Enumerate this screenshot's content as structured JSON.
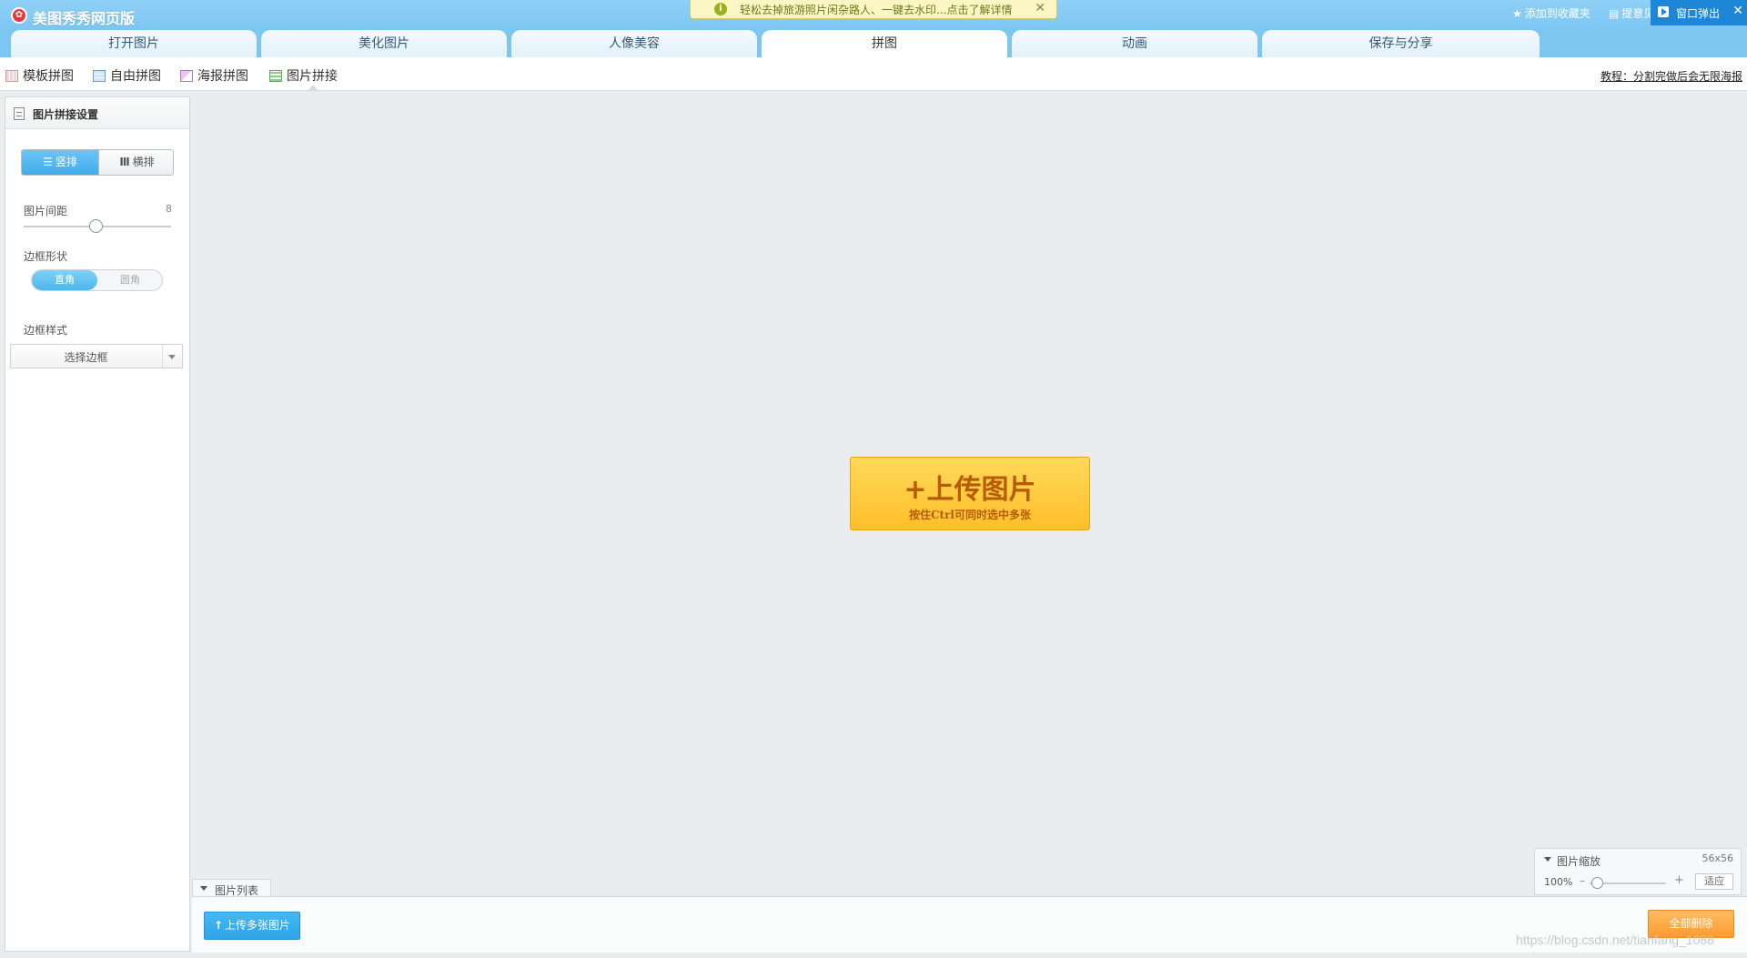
{
  "app": {
    "title": "美图秀秀网页版",
    "notice": "轻松去掉旅游照片闲杂路人、一键去水印...点击了解详情",
    "add_favorite": "添加到收藏夹",
    "feedback": "提意见",
    "popup_window": "窗口弹出"
  },
  "tabs": [
    {
      "label": "打开图片",
      "active": false
    },
    {
      "label": "美化图片",
      "active": false
    },
    {
      "label": "人像美容",
      "active": false
    },
    {
      "label": "拼图",
      "active": true
    },
    {
      "label": "动画",
      "active": false
    },
    {
      "label": "保存与分享",
      "active": false
    }
  ],
  "subtoolbar": {
    "items": [
      {
        "label": "模板拼图",
        "icon": "template-collage-icon"
      },
      {
        "label": "自由拼图",
        "icon": "free-collage-icon"
      },
      {
        "label": "海报拼图",
        "icon": "poster-collage-icon"
      },
      {
        "label": "图片拼接",
        "icon": "image-stitch-icon"
      }
    ],
    "active_index": 3,
    "tutorial": "教程：分割完做后会无限海报"
  },
  "settings_panel": {
    "title": "图片拼接设置",
    "layout_vertical": "竖排",
    "layout_horizontal": "横排",
    "spacing_label": "图片间距",
    "spacing_value": "8",
    "spacing_slider": 0.5,
    "border_shape_label": "边框形状",
    "shape_square": "直角",
    "shape_round": "圆角",
    "border_style_label": "边框样式",
    "border_select": "选择边框"
  },
  "canvas": {
    "upload_label": "+上传图片",
    "upload_hint": "按住Ctrl可同时选中多张"
  },
  "zoom": {
    "title": "图片缩放",
    "size": "56x56",
    "percent": "100%",
    "minus": "–",
    "plus": "+",
    "fit": "适应"
  },
  "image_list": {
    "tab_label": "图片列表",
    "upload_multi": "上传多张图片",
    "delete_all": "全部删除"
  },
  "watermark": "https://blog.csdn.net/tianfang_1088",
  "colors": {
    "titlebar": "#7cc6f2",
    "accent_blue": "#41aceb",
    "upload_yellow": "#ffbf2a",
    "delete_orange": "#ff9a2e"
  }
}
